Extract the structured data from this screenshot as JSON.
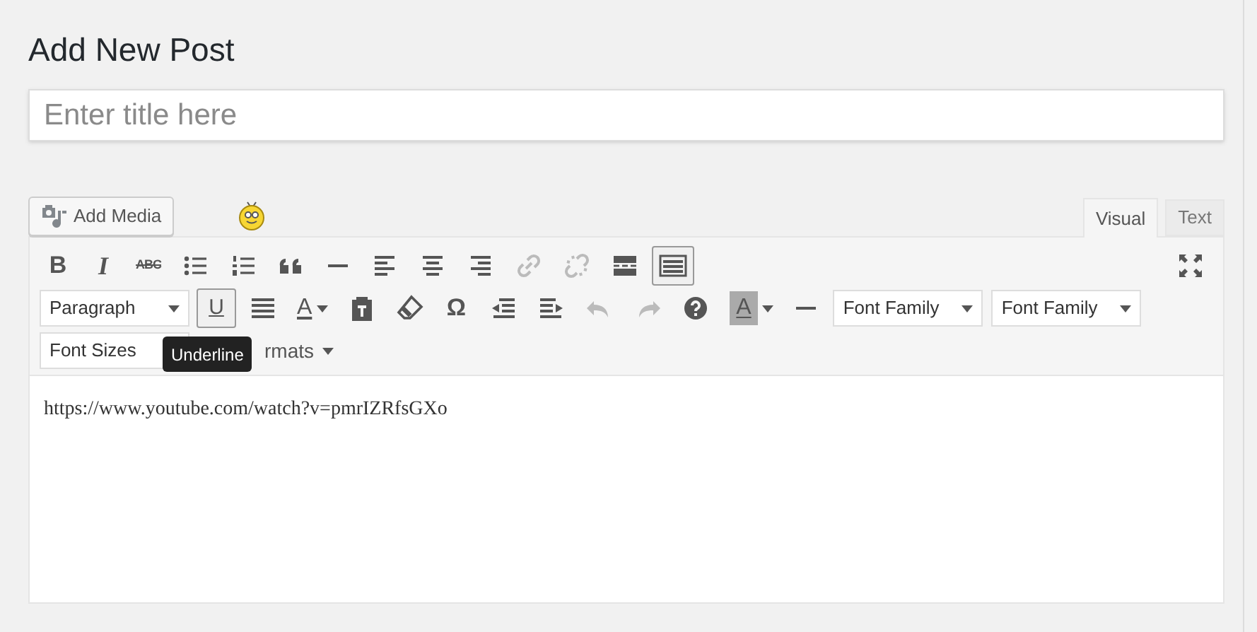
{
  "heading": "Add New Post",
  "title_field": {
    "placeholder": "Enter title here"
  },
  "add_media": {
    "label": "Add Media"
  },
  "editor_tabs": [
    {
      "label": "Visual",
      "selected": true
    },
    {
      "label": "Text",
      "selected": false
    }
  ],
  "toolbar_rows": [
    {
      "items": [
        {
          "kind": "bold",
          "label": "B",
          "disabled": false,
          "active": false
        },
        {
          "kind": "italic",
          "label": "I",
          "disabled": false,
          "active": false
        },
        {
          "kind": "strikethrough",
          "label": "ABC",
          "disabled": false,
          "active": false
        },
        {
          "kind": "bullet-list",
          "disabled": false,
          "active": false
        },
        {
          "kind": "numbered-list",
          "disabled": false,
          "active": false
        },
        {
          "kind": "blockquote",
          "disabled": false,
          "active": false
        },
        {
          "kind": "horizontal-line",
          "disabled": false,
          "active": false
        },
        {
          "kind": "align-left",
          "disabled": false,
          "active": false
        },
        {
          "kind": "align-center",
          "disabled": false,
          "active": false
        },
        {
          "kind": "align-right",
          "disabled": false,
          "active": false
        },
        {
          "kind": "link",
          "disabled": true,
          "active": false
        },
        {
          "kind": "unlink",
          "disabled": true,
          "active": false
        },
        {
          "kind": "read-more",
          "disabled": false,
          "active": false
        },
        {
          "kind": "toolbar-toggle",
          "disabled": false,
          "active": true
        },
        {
          "kind": "fullscreen",
          "disabled": false,
          "active": false
        }
      ]
    },
    {
      "items": [
        {
          "kind": "select",
          "label": "Paragraph"
        },
        {
          "kind": "underline",
          "label": "U",
          "disabled": false,
          "active": true
        },
        {
          "kind": "justify",
          "disabled": false,
          "active": false
        },
        {
          "kind": "text-color",
          "label": "A",
          "disabled": false,
          "active": false
        },
        {
          "kind": "paste-text",
          "disabled": false,
          "active": false
        },
        {
          "kind": "eraser",
          "disabled": false,
          "active": false
        },
        {
          "kind": "special-character",
          "label": "Ω",
          "disabled": false,
          "active": false
        },
        {
          "kind": "outdent",
          "disabled": false,
          "active": false
        },
        {
          "kind": "indent",
          "disabled": false,
          "active": false
        },
        {
          "kind": "undo",
          "disabled": true,
          "active": false
        },
        {
          "kind": "redo",
          "disabled": true,
          "active": false
        },
        {
          "kind": "help",
          "disabled": false,
          "active": false
        },
        {
          "kind": "background-color",
          "label": "A",
          "disabled": false,
          "active": false
        },
        {
          "kind": "horizontal-line",
          "disabled": false,
          "active": false
        },
        {
          "kind": "select",
          "label": "Font Family"
        },
        {
          "kind": "select",
          "label": "Font Family"
        }
      ]
    },
    {
      "items": [
        {
          "kind": "select",
          "label": "Font Sizes"
        },
        {
          "kind": "menu",
          "label": "rmats"
        }
      ]
    }
  ],
  "tooltip": "Underline",
  "content": "https://www.youtube.com/watch?v=pmrIZRfsGXo"
}
